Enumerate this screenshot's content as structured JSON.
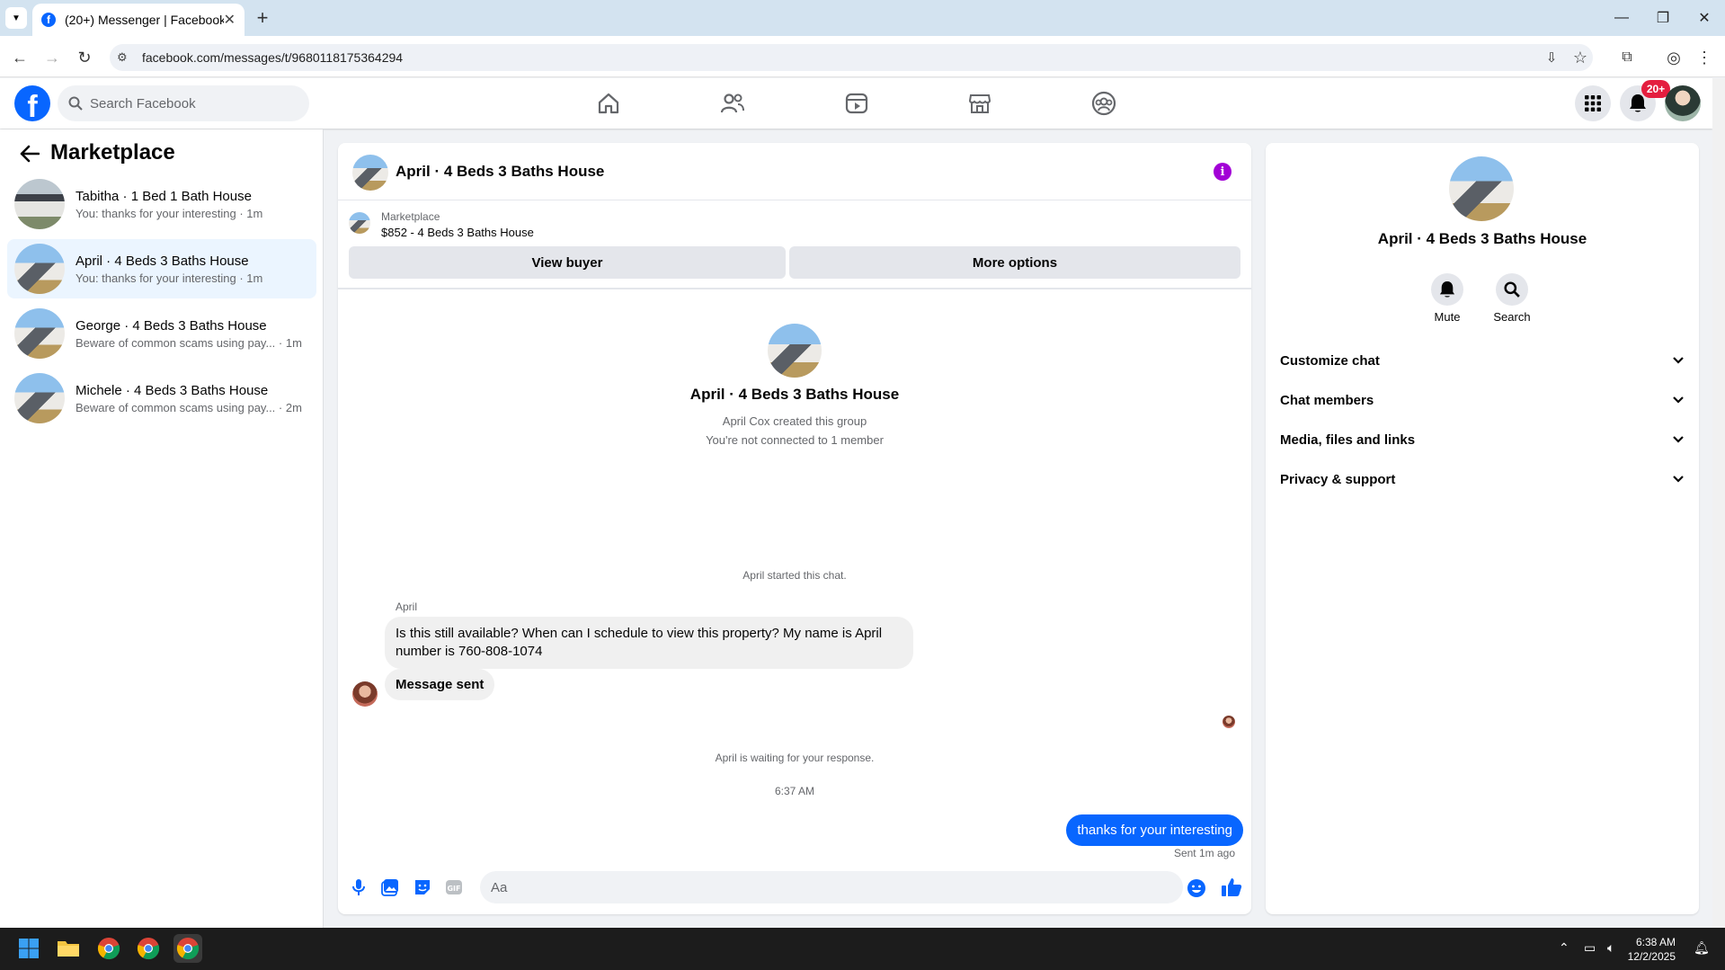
{
  "browser": {
    "tab_title": "(20+) Messenger | Facebook",
    "url": "facebook.com/messages/t/9680118175364294"
  },
  "fb": {
    "search_placeholder": "Search Facebook",
    "notification_count": "20+",
    "brand_color": "#0866ff"
  },
  "left": {
    "title": "Marketplace",
    "conversations": [
      {
        "name": "Tabitha · 1 Bed 1 Bath House",
        "preview": "You: thanks for your interesting · 1m"
      },
      {
        "name": "April · 4 Beds 3 Baths House",
        "preview": "You: thanks for your interesting · 1m"
      },
      {
        "name": "George · 4 Beds 3 Baths House",
        "preview": "Beware of common scams using pay... · 1m"
      },
      {
        "name": "Michele · 4 Beds 3 Baths House",
        "preview": "Beware of common scams using pay... · 2m"
      }
    ]
  },
  "chat": {
    "title": "April · 4 Beds 3 Baths House",
    "listing_label": "Marketplace",
    "listing_price": "$852 - 4 Beds 3 Baths House",
    "view_buyer": "View buyer",
    "more_options": "More options",
    "group_created": "April Cox created this group",
    "not_connected": "You're not connected to 1 member",
    "started": "April started this chat.",
    "sender": "April",
    "message1": "Is this still available? When can I schedule to view this property? My name is April number is 760-808-1074",
    "message2": "Message sent",
    "waiting": "April is waiting for your response.",
    "time": "6:37 AM",
    "outgoing": "thanks for your interesting",
    "sent_status": "Sent 1m ago",
    "composer_placeholder": "Aa"
  },
  "right": {
    "title": "April · 4 Beds 3 Baths House",
    "mute": "Mute",
    "search": "Search",
    "sections": [
      "Customize chat",
      "Chat members",
      "Media, files and links",
      "Privacy & support"
    ]
  },
  "taskbar": {
    "time": "6:38 AM",
    "date": "12/2/2025"
  }
}
